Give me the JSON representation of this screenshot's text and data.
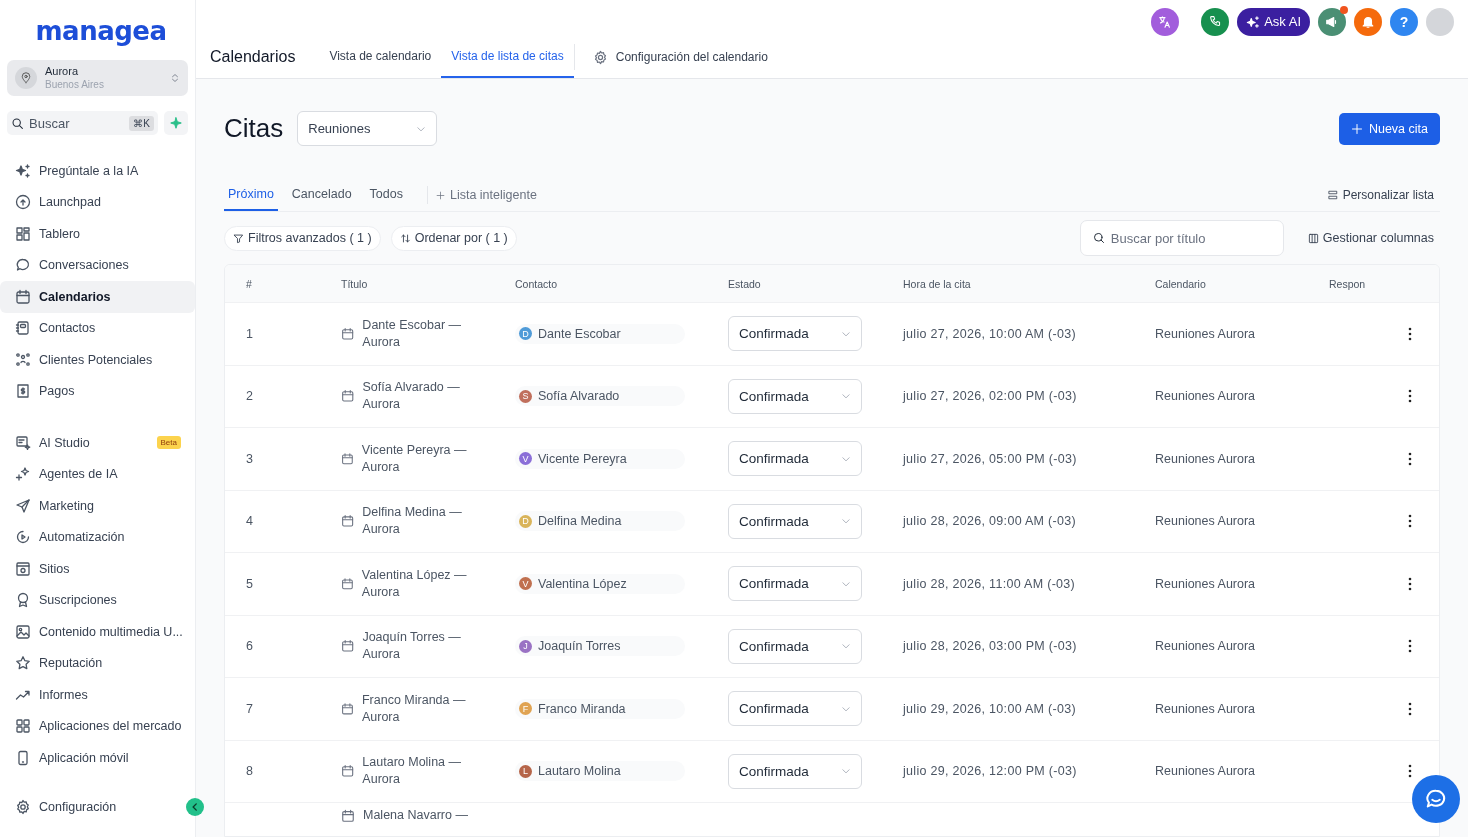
{
  "logo": "managea",
  "account": {
    "name": "Aurora",
    "location": "Buenos Aires"
  },
  "search": {
    "placeholder": "Buscar",
    "shortcut": "⌘K"
  },
  "nav_sections": [
    [
      {
        "label": "Pregúntale a la IA",
        "selected": false
      },
      {
        "label": "Launchpad",
        "selected": false
      },
      {
        "label": "Tablero",
        "selected": false
      },
      {
        "label": "Conversaciones",
        "selected": false
      },
      {
        "label": "Calendarios",
        "selected": true
      },
      {
        "label": "Contactos",
        "selected": false
      },
      {
        "label": "Clientes Potenciales",
        "selected": false
      },
      {
        "label": "Pagos",
        "selected": false
      }
    ],
    [
      {
        "label": "AI Studio",
        "selected": false,
        "badge": "Beta"
      },
      {
        "label": "Agentes de IA",
        "selected": false
      },
      {
        "label": "Marketing",
        "selected": false
      },
      {
        "label": "Automatización",
        "selected": false
      },
      {
        "label": "Sitios",
        "selected": false
      },
      {
        "label": "Suscripciones",
        "selected": false
      },
      {
        "label": "Contenido multimedia U...",
        "selected": false
      },
      {
        "label": "Reputación",
        "selected": false
      },
      {
        "label": "Informes",
        "selected": false
      },
      {
        "label": "Aplicaciones del mercado",
        "selected": false
      },
      {
        "label": "Aplicación móvil",
        "selected": false
      }
    ]
  ],
  "settings": {
    "label": "Configuración",
    "selected": false
  },
  "top_actions": {
    "ask_ai": "Ask AI",
    "announcements_unread": true,
    "help": "?"
  },
  "header": {
    "title": "Calendarios",
    "tabs": [
      {
        "label": "Vista de calendario",
        "selected": false
      },
      {
        "label": "Vista de lista de citas",
        "selected": true
      }
    ],
    "settings_link": "Configuración del calendario"
  },
  "page": {
    "title": "Citas",
    "calendar_select": "Reuniones",
    "new_button": "Nueva cita"
  },
  "list_tabs": [
    {
      "label": "Próximo",
      "selected": true
    },
    {
      "label": "Cancelado",
      "selected": false
    },
    {
      "label": "Todos",
      "selected": false
    }
  ],
  "smart_list": "Lista inteligente",
  "customize": "Personalizar lista",
  "filters": [
    "Filtros avanzados ( 1 )",
    "Ordenar por ( 1 )"
  ],
  "title_search": {
    "placeholder": "Buscar por título"
  },
  "manage_columns": "Gestionar columnas",
  "table": {
    "columns": [
      "#",
      "Título",
      "Contacto",
      "Estado",
      "Hora de la cita",
      "Calendario",
      "Respon"
    ],
    "rows": [
      {
        "kind": "full",
        "number": "1",
        "title": "Dante Escobar — Aurora",
        "contact": {
          "initial": "D",
          "name": "Dante Escobar",
          "color": "#4f9bd8"
        },
        "status": "Confirmada",
        "time": "julio 27, 2026, 10:00 AM (-03)",
        "calendar": "Reuniones Aurora"
      },
      {
        "kind": "full",
        "number": "2",
        "title": "Sofía Alvarado — Aurora",
        "contact": {
          "initial": "S",
          "name": "Sofía Alvarado",
          "color": "#c06f5c"
        },
        "status": "Confirmada",
        "time": "julio 27, 2026, 02:00 PM (-03)",
        "calendar": "Reuniones Aurora"
      },
      {
        "kind": "full",
        "number": "3",
        "title": "Vicente Pereyra — Aurora",
        "contact": {
          "initial": "V",
          "name": "Vicente Pereyra",
          "color": "#8b6fd8"
        },
        "status": "Confirmada",
        "time": "julio 27, 2026, 05:00 PM (-03)",
        "calendar": "Reuniones Aurora"
      },
      {
        "kind": "full",
        "number": "4",
        "title": "Delfina Medina — Aurora",
        "contact": {
          "initial": "D",
          "name": "Delfina Medina",
          "color": "#d9b45a"
        },
        "status": "Confirmada",
        "time": "julio 28, 2026, 09:00 AM (-03)",
        "calendar": "Reuniones Aurora"
      },
      {
        "kind": "full",
        "number": "5",
        "title": "Valentina López — Aurora",
        "contact": {
          "initial": "V",
          "name": "Valentina López",
          "color": "#c0704f"
        },
        "status": "Confirmada",
        "time": "julio 28, 2026, 11:00 AM (-03)",
        "calendar": "Reuniones Aurora"
      },
      {
        "kind": "full",
        "number": "6",
        "title": "Joaquín Torres — Aurora",
        "contact": {
          "initial": "J",
          "name": "Joaquín Torres",
          "color": "#9a72c4"
        },
        "status": "Confirmada",
        "time": "julio 28, 2026, 03:00 PM (-03)",
        "calendar": "Reuniones Aurora"
      },
      {
        "kind": "full",
        "number": "7",
        "title": "Franco Miranda — Aurora",
        "contact": {
          "initial": "F",
          "name": "Franco Miranda",
          "color": "#e0a352"
        },
        "status": "Confirmada",
        "time": "julio 29, 2026, 10:00 AM (-03)",
        "calendar": "Reuniones Aurora"
      },
      {
        "kind": "full",
        "number": "8",
        "title": "Lautaro Molina — Aurora",
        "contact": {
          "initial": "L",
          "name": "Lautaro Molina",
          "color": "#b5654a"
        },
        "status": "Confirmada",
        "time": "julio 29, 2026, 12:00 PM (-03)",
        "calendar": "Reuniones Aurora"
      },
      {
        "kind": "partial",
        "title": "Malena Navarro —"
      }
    ]
  }
}
